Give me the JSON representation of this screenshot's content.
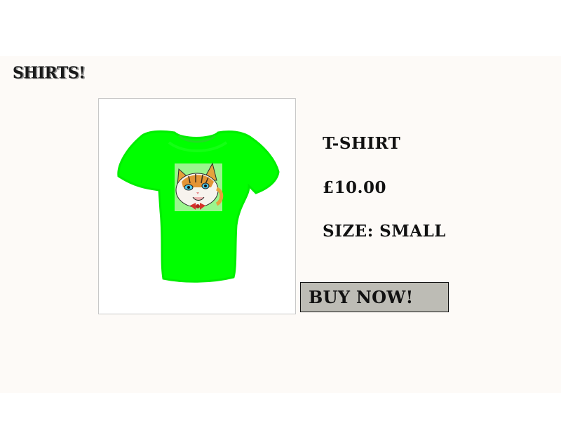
{
  "header": {
    "brand": "SHIRTS!"
  },
  "product": {
    "image_icon": "t-shirt-with-cat-print",
    "shirt_color": "#00ff00",
    "name": "T-SHIRT",
    "price": "£10.00",
    "size": "SIZE: SMALL"
  },
  "actions": {
    "buy_label": "BUY NOW!"
  },
  "colors": {
    "page_background": "#fdfaf7",
    "button_background": "#bdbcb5",
    "text": "#111111"
  }
}
